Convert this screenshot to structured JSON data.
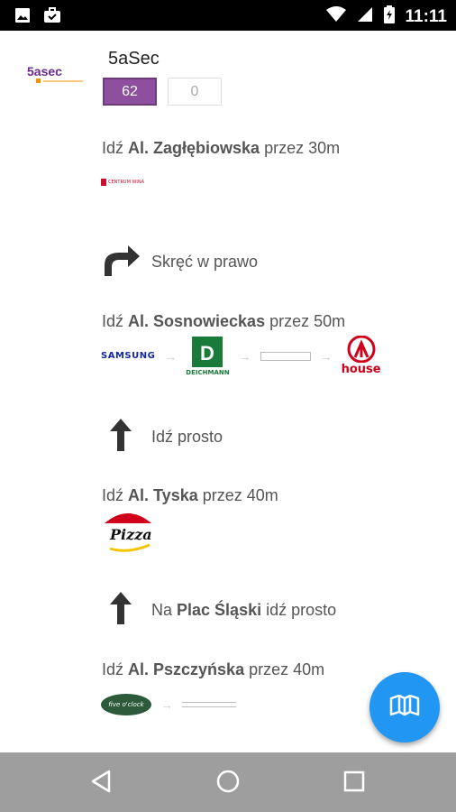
{
  "status_bar": {
    "time": "11:11",
    "icons": [
      "image-icon",
      "briefcase-icon",
      "wifi-icon",
      "signal-icon",
      "battery-icon"
    ]
  },
  "header": {
    "logo_text": "5asec",
    "store_name": "5aSec",
    "count_primary": "62",
    "count_secondary": "0"
  },
  "steps": [
    {
      "prefix": "Idź ",
      "street": "Al. Zagłębiowska",
      "suffix": " przez 30m",
      "logos": [
        "CENTRUM WINA"
      ]
    },
    {
      "turn": "Skręć w prawo",
      "icon": "turn-right-arrow-icon"
    },
    {
      "prefix": "Idź ",
      "street": "Al. Sosnowieckas",
      "suffix": " przez 50m",
      "logos": [
        "SAMSUNG",
        "DEICHMANN",
        "house"
      ]
    },
    {
      "turn": "Idź prosto",
      "icon": "straight-arrow-icon"
    },
    {
      "prefix": "Idź ",
      "street": "Al. Tyska",
      "suffix": " przez 40m",
      "logos": [
        "Pizza Hut"
      ]
    },
    {
      "turn_prefix": "Na ",
      "turn_bold": "Plac Śląski",
      "turn_suffix": " idź prosto",
      "icon": "straight-arrow-icon"
    },
    {
      "prefix": "Idź ",
      "street": "Al. Pszczyńska",
      "suffix": " przez 40m",
      "logos": [
        "five o'clock"
      ]
    }
  ],
  "colors": {
    "accent_purple": "#8e4f9e",
    "fab_blue": "#2196f3",
    "nav_bar": "#9e9e9e",
    "deichmann_green": "#1a7a3a",
    "house_red": "#d0021b"
  },
  "fab": {
    "icon": "map-icon"
  },
  "nav": {
    "icons": [
      "back-icon",
      "home-icon",
      "recents-icon"
    ]
  }
}
